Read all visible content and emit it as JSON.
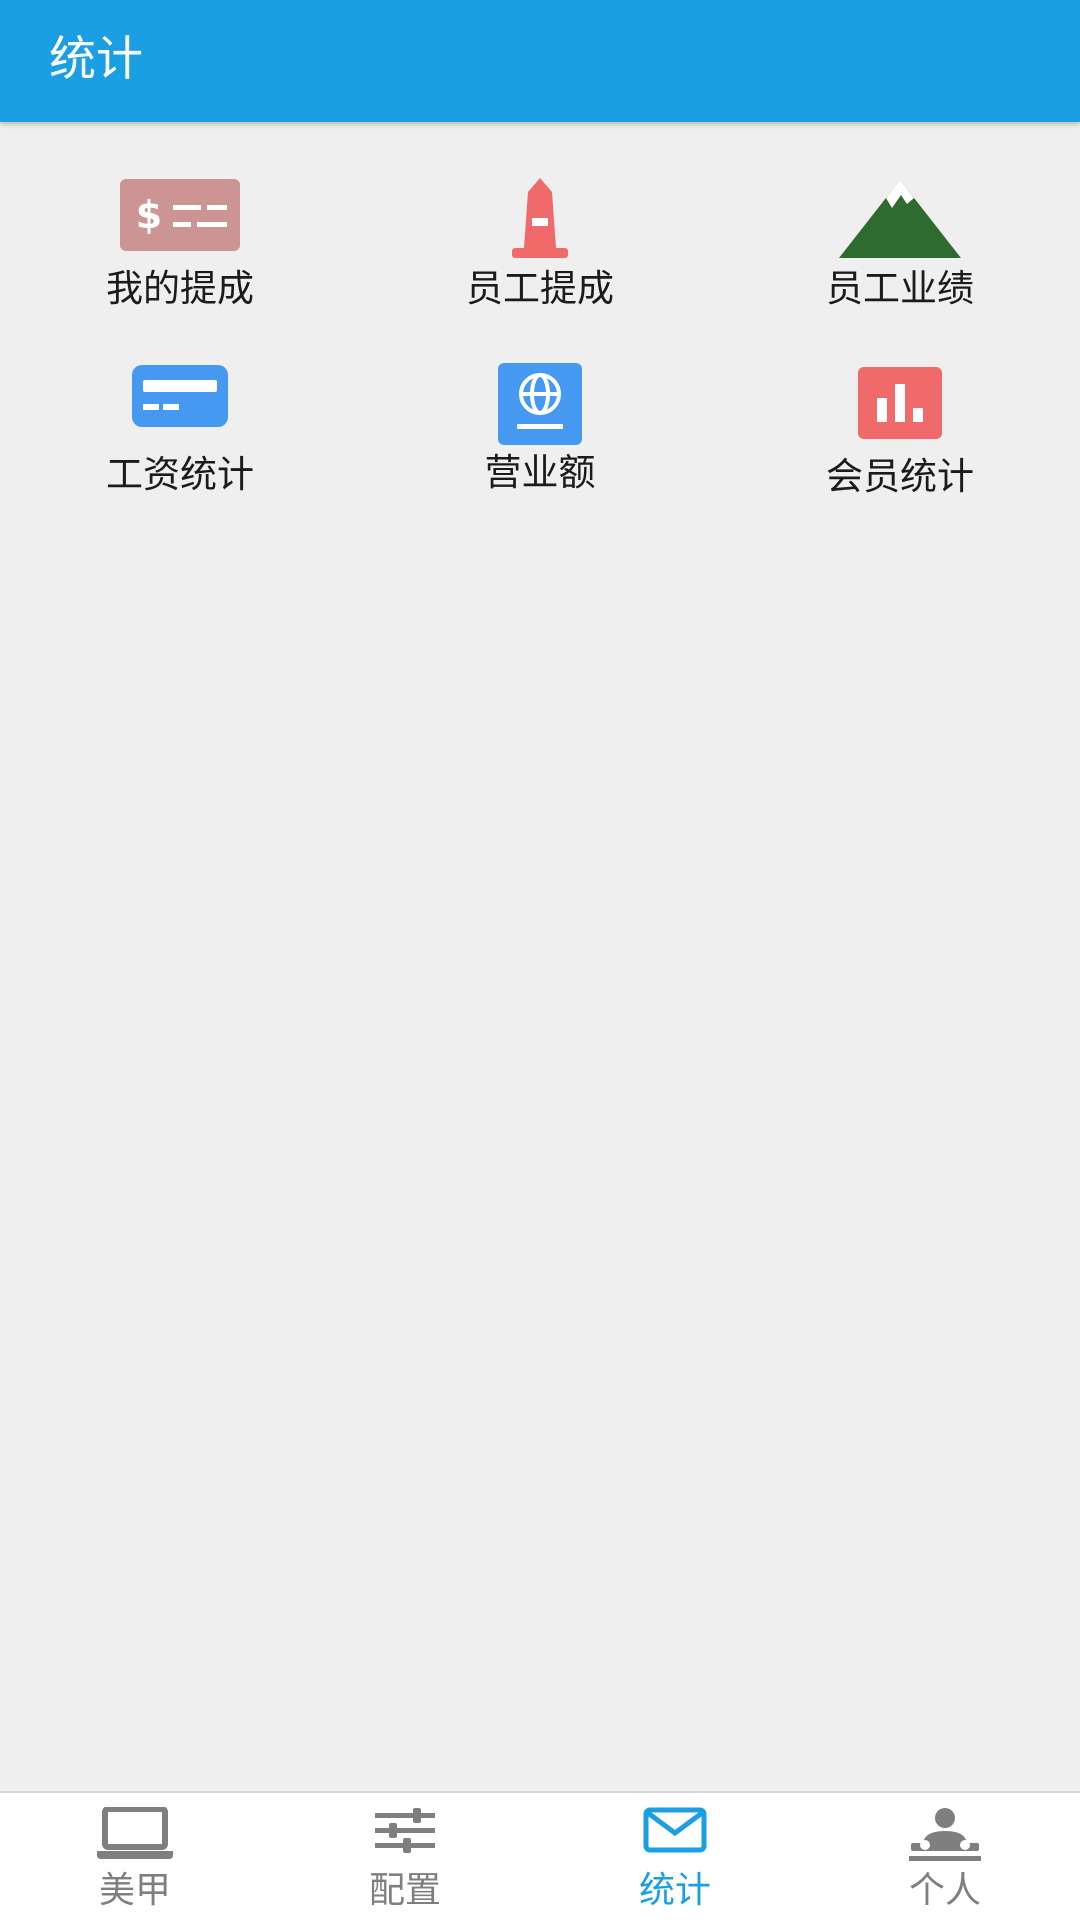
{
  "app_bar": {
    "title": "统计",
    "background": "#1a9fe3"
  },
  "grid": {
    "items": [
      {
        "label": "我的提成",
        "icon": "dollar-card-icon",
        "color": "#cd9494"
      },
      {
        "label": "员工提成",
        "icon": "bollard-icon",
        "color": "#f0696b"
      },
      {
        "label": "员工业绩",
        "icon": "mountain-icon",
        "color": "#2e6b2e"
      },
      {
        "label": "工资统计",
        "icon": "card-icon",
        "color": "#4599f1"
      },
      {
        "label": "营业额",
        "icon": "globe-book-icon",
        "color": "#4599f1"
      },
      {
        "label": "会员统计",
        "icon": "bar-chart-icon",
        "color": "#f0696b"
      }
    ]
  },
  "bottom_nav": {
    "items": [
      {
        "label": "美甲",
        "icon": "laptop-icon",
        "active": false
      },
      {
        "label": "配置",
        "icon": "sliders-icon",
        "active": false
      },
      {
        "label": "统计",
        "icon": "mail-icon",
        "active": true
      },
      {
        "label": "个人",
        "icon": "user-dj-icon",
        "active": false
      }
    ],
    "active_color": "#1a9fe3",
    "inactive_color": "#7f7f7f"
  }
}
